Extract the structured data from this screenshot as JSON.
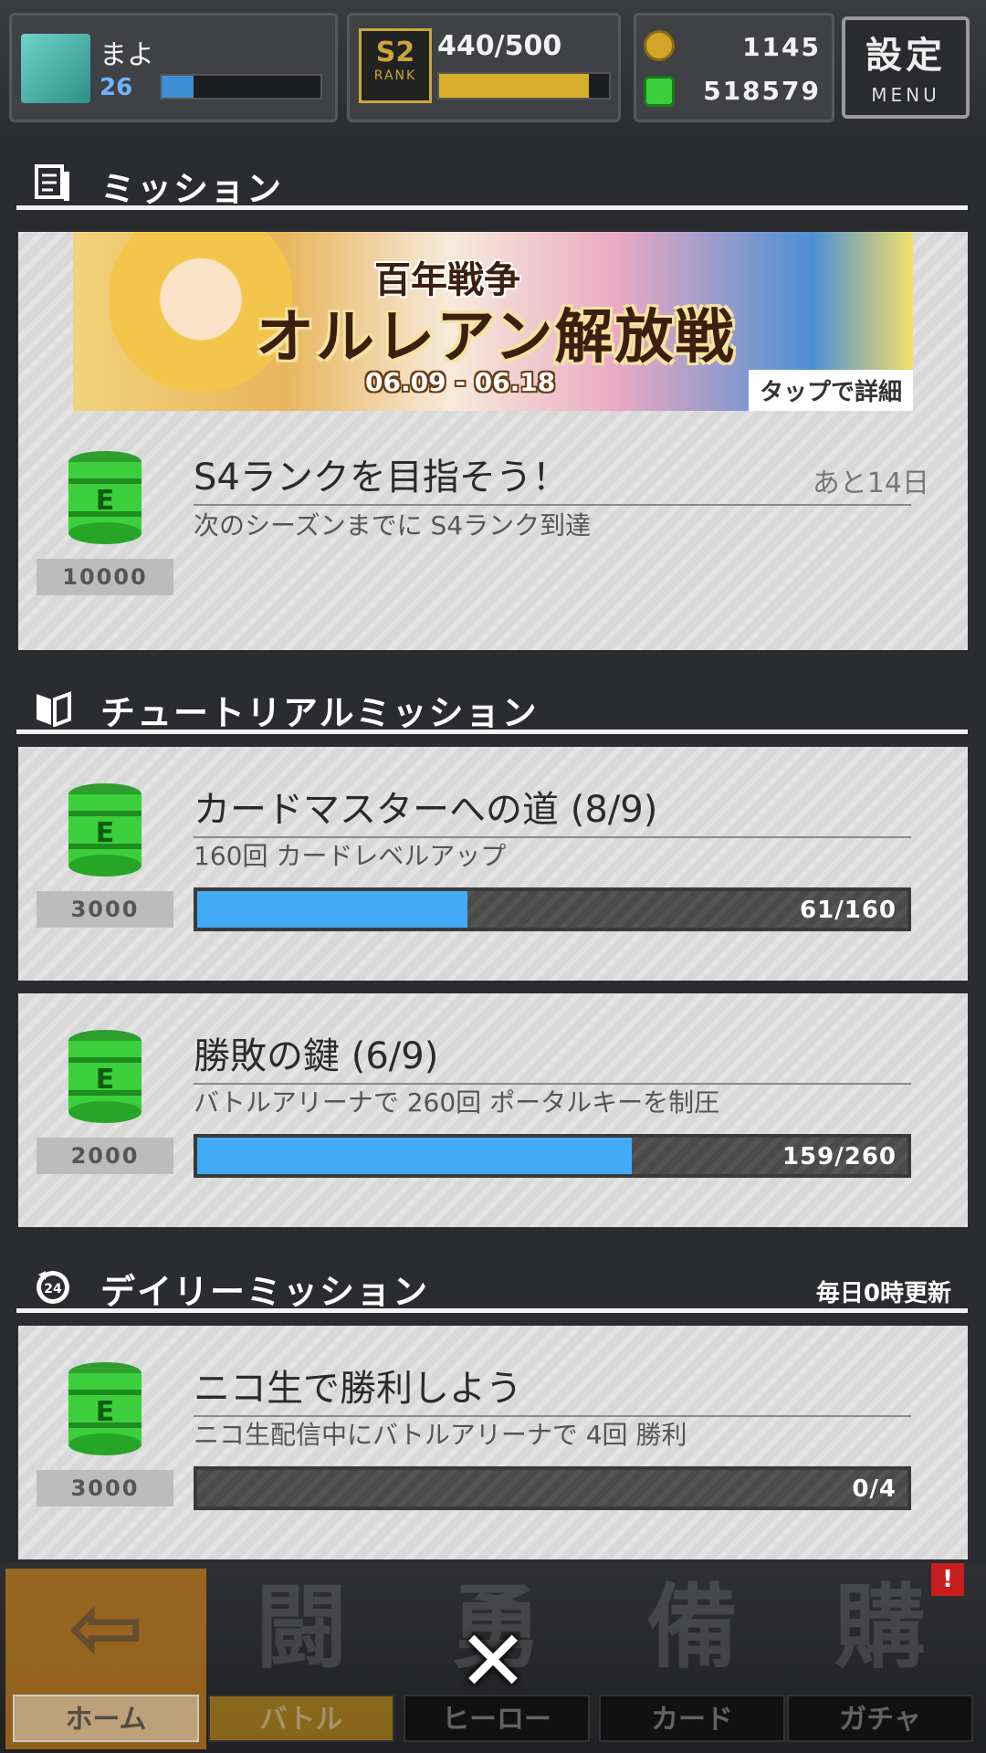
{
  "header": {
    "player_name": "まよ",
    "player_level": "26",
    "player_exp_fraction": 0.2,
    "rank_badge": "S2",
    "rank_badge_sub": "RANK",
    "rank_points": "440/500",
    "rank_fraction": 0.88,
    "coins": "1145",
    "green_currency": "518579",
    "menu_kanji": "設定",
    "menu_label": "MENU"
  },
  "sections": {
    "mission": "ミッション",
    "tutorial": "チュートリアルミッション",
    "daily": "デイリーミッション",
    "daily_note": "毎日0時更新"
  },
  "banner": {
    "title_top": "百年戦争",
    "title_main": "オルレアン解放戦",
    "dates": "06.09 - 06.18",
    "tap_label": "タップで詳細"
  },
  "missions": [
    {
      "reward": "10000",
      "title": "S4ランクを目指そう！",
      "deadline": "あと14日",
      "desc": "次のシーズンまでに S4ランク到達"
    },
    {
      "reward": "3000",
      "title": "カードマスターへの道 (8/9)",
      "desc": "160回 カードレベルアップ",
      "progress_text": "61/160",
      "progress": 0.381
    },
    {
      "reward": "2000",
      "title": "勝敗の鍵 (6/9)",
      "desc": "バトルアリーナで 260回 ポータルキーを制圧",
      "progress_text": "159/260",
      "progress": 0.612
    },
    {
      "reward": "3000",
      "title": "ニコ生で勝利しよう",
      "desc": "ニコ生配信中にバトルアリーナで 4回 勝利",
      "progress_text": "0/4",
      "progress": 0
    }
  ],
  "nav": [
    {
      "label": "ホーム",
      "glyph": "⇦",
      "icon": "home-icon"
    },
    {
      "label": "バトル",
      "glyph": "闘",
      "icon": "battle-icon"
    },
    {
      "label": "ヒーロー",
      "glyph": "勇",
      "icon": "hero-icon"
    },
    {
      "label": "カード",
      "glyph": "備",
      "icon": "card-icon"
    },
    {
      "label": "ガチャ",
      "glyph": "購",
      "icon": "gacha-icon"
    }
  ],
  "close_glyph": "✕",
  "shop_badge": "!",
  "colors": {
    "progress_fill": "#42aaf6",
    "reward_green": "#3ccf3c",
    "rank_gold": "#d8b02e"
  }
}
